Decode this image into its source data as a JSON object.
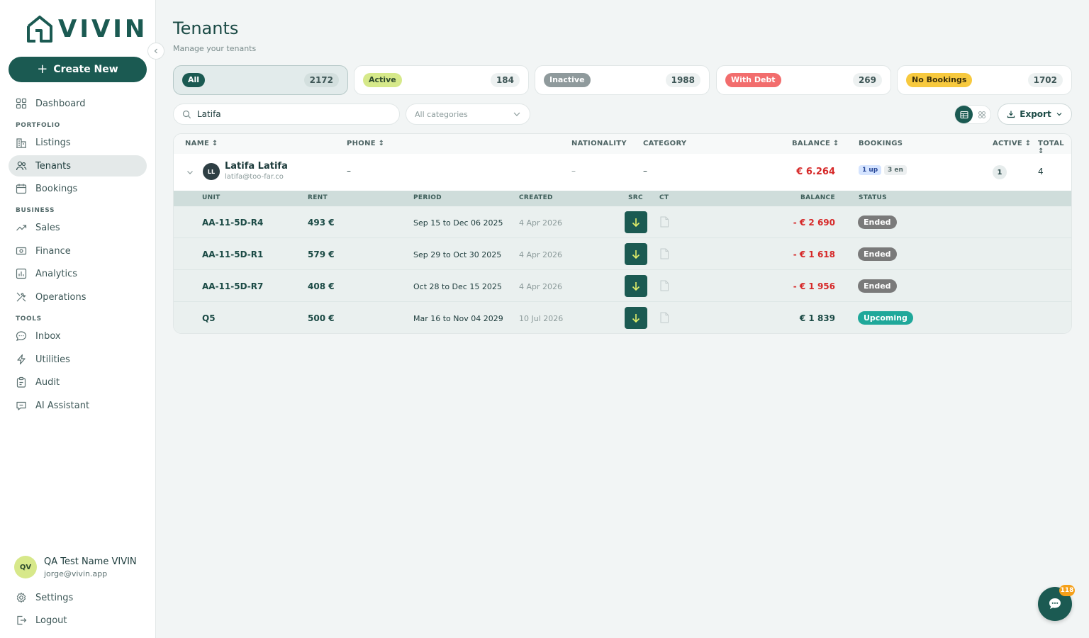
{
  "brand": {
    "name": "VIVIN",
    "color": "#1b5a52"
  },
  "sidebar": {
    "create_label": "Create New",
    "sections": {
      "portfolio": "PORTFOLIO",
      "business": "BUSINESS",
      "tools": "TOOLS"
    },
    "items": [
      {
        "label": "Dashboard",
        "icon": "grid-icon"
      },
      {
        "label": "Listings",
        "icon": "building-icon"
      },
      {
        "label": "Tenants",
        "icon": "users-icon",
        "active": true
      },
      {
        "label": "Bookings",
        "icon": "calendar-icon"
      },
      {
        "label": "Sales",
        "icon": "trend-icon"
      },
      {
        "label": "Finance",
        "icon": "money-icon"
      },
      {
        "label": "Analytics",
        "icon": "chart-icon"
      },
      {
        "label": "Operations",
        "icon": "tools-icon"
      },
      {
        "label": "Inbox",
        "icon": "chat-icon"
      },
      {
        "label": "Utilities",
        "icon": "bolt-icon"
      },
      {
        "label": "Audit",
        "icon": "clipboard-icon"
      },
      {
        "label": "AI Assistant",
        "icon": "assistant-icon"
      }
    ],
    "user": {
      "initials": "QV",
      "name": "QA Test Name VIVIN",
      "email": "jorge@vivin.app"
    },
    "settings_label": "Settings",
    "logout_label": "Logout"
  },
  "header": {
    "title": "Tenants",
    "subtitle": "Manage your tenants"
  },
  "filters": [
    {
      "label": "All",
      "count": "2172",
      "color": "#1b5a52",
      "text": "#ffffff",
      "selected": true
    },
    {
      "label": "Active",
      "count": "184",
      "color": "#d6e98a",
      "text": "#2d4a2d"
    },
    {
      "label": "Inactive",
      "count": "1988",
      "color": "#8f9a9c",
      "text": "#ffffff"
    },
    {
      "label": "With Debt",
      "count": "269",
      "color": "#f26d6d",
      "text": "#ffffff"
    },
    {
      "label": "No Bookings",
      "count": "1702",
      "color": "#f7c93e",
      "text": "#3a2e0a"
    }
  ],
  "search": {
    "value": "Latifa"
  },
  "category_select": {
    "placeholder": "All categories"
  },
  "export_label": "Export",
  "table": {
    "columns": {
      "name": "NAME ↕",
      "phone": "PHONE ↕",
      "nationality": "NATIONALITY",
      "category": "CATEGORY",
      "balance": "BALANCE ↕",
      "bookings": "BOOKINGS",
      "active": "ACTIVE ↕",
      "total": "TOTAL ↕"
    },
    "tenant": {
      "initials": "LL",
      "name": "Latifa Latifa",
      "email": "latifa@too-far.co",
      "phone": "–",
      "nationality": "–",
      "category": "–",
      "balance": "€ 6.264",
      "bookings_up": "1 up",
      "bookings_en": "3 en",
      "active": "1",
      "total": "4"
    },
    "sub_columns": {
      "unit": "UNIT",
      "rent": "RENT",
      "period": "PERIOD",
      "created": "CREATED",
      "src": "SRC",
      "ct": "CT",
      "balance": "BALANCE",
      "status": "STATUS"
    },
    "bookings": [
      {
        "unit": "AA-11-5D-R4",
        "rent": "493 €",
        "period": "Sep 15 to Dec 06 2025",
        "created": "4 Apr 2026",
        "balance": "- € 2 690",
        "negative": true,
        "status": "Ended"
      },
      {
        "unit": "AA-11-5D-R1",
        "rent": "579 €",
        "period": "Sep 29 to Oct 30 2025",
        "created": "4 Apr 2026",
        "balance": "- € 1 618",
        "negative": true,
        "status": "Ended"
      },
      {
        "unit": "AA-11-5D-R7",
        "rent": "408 €",
        "period": "Oct 28 to Dec 15 2025",
        "created": "4 Apr 2026",
        "balance": "- € 1 956",
        "negative": true,
        "status": "Ended"
      },
      {
        "unit": "Q5",
        "rent": "500 €",
        "period": "Mar 16 to Nov 04 2029",
        "created": "10 Jul 2026",
        "balance": "€ 1 839",
        "negative": false,
        "status": "Upcoming"
      }
    ]
  },
  "chat": {
    "badge": "118"
  },
  "colors": {
    "negative": "#d62828",
    "ended": "#7a7a7a",
    "upcoming": "#1fa89a"
  }
}
